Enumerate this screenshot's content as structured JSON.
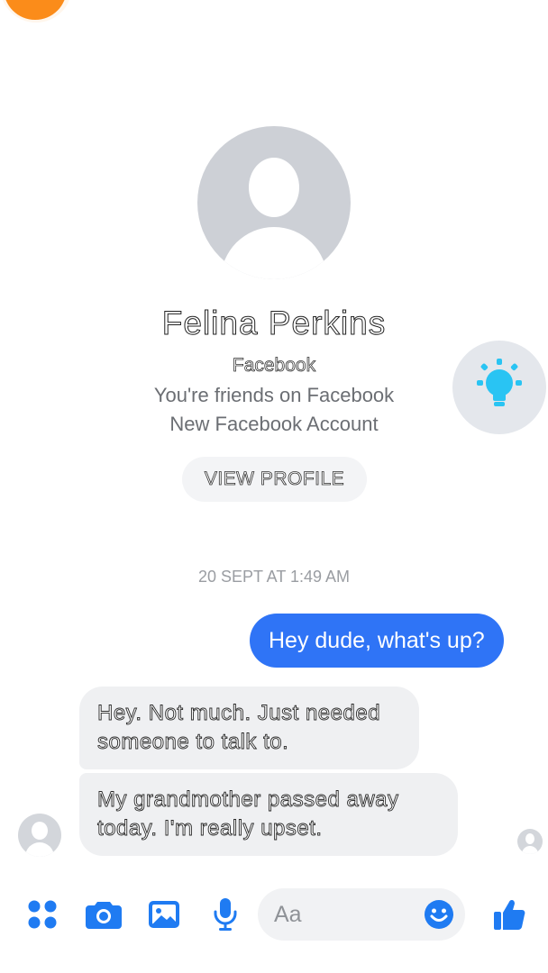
{
  "contact": {
    "name": "Felina Perkins",
    "source": "Facebook",
    "friendship": "You're friends on Facebook",
    "account_note": "New Facebook Account",
    "view_profile_label": "VIEW PROFILE"
  },
  "conversation": {
    "timestamp": "20 SEPT AT 1:49 AM",
    "messages": [
      {
        "direction": "outgoing",
        "text": "Hey dude, what's up?"
      },
      {
        "direction": "incoming",
        "text": "Hey. Not much. Just needed someone to talk to."
      },
      {
        "direction": "incoming",
        "text": "My grandmother passed away today. I'm really upset."
      }
    ]
  },
  "composer": {
    "placeholder": "Aa",
    "icons": [
      "apps-icon",
      "camera-icon",
      "gallery-icon",
      "microphone-icon",
      "emoji-icon",
      "thumbs-up-icon"
    ]
  },
  "floating": {
    "icon": "lightbulb-icon"
  },
  "colors": {
    "accent": "#2f74f6",
    "incoming_bubble": "#eff0f2",
    "avatar_placeholder": "#cdd0d6",
    "bulb": "#29c4f3",
    "corner_badge": "#fb8c1a"
  }
}
